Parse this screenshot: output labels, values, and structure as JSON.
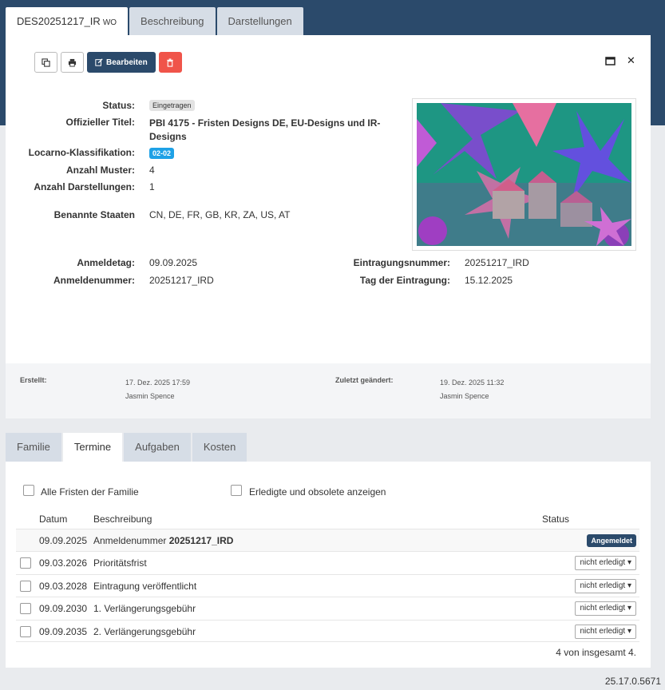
{
  "tabs": [
    {
      "label": "DES20251217_IR",
      "sub": "WO"
    },
    {
      "label": "Beschreibung"
    },
    {
      "label": "Darstellungen"
    }
  ],
  "toolbar": {
    "edit_label": "Bearbeiten"
  },
  "icons": {
    "copy": "copy-icon",
    "print": "print-icon",
    "edit": "edit-icon",
    "delete": "trash-icon",
    "maximize": "maximize-icon",
    "close": "close-icon"
  },
  "details": {
    "status_label": "Status:",
    "status_value": "Eingetragen",
    "title_label": "Offizieller Titel:",
    "title_line1": "PBI 4175 - Fristen Designs DE, EU-Designs und IR-",
    "title_line2": "Designs",
    "locarno_label": "Locarno-Klassifikation:",
    "locarno_value": "02-02",
    "muster_label": "Anzahl Muster:",
    "muster_value": "4",
    "darst_label": "Anzahl Darstellungen:",
    "darst_value": "1",
    "staaten_label": "Benannte Staaten",
    "staaten_value": "CN, DE, FR, GB, KR, ZA, US, AT",
    "anmeldetag_label": "Anmeldetag:",
    "anmeldetag_value": "09.09.2025",
    "anmeldenummer_label": "Anmeldenummer:",
    "anmeldenummer_value": "20251217_IRD",
    "eintragungsnummer_label": "Eintragungsnummer:",
    "eintragungsnummer_value": "20251217_IRD",
    "eintragungstag_label": "Tag der Eintragung:",
    "eintragungstag_value": "15.12.2025"
  },
  "meta": {
    "created_label": "Erstellt:",
    "created_date": "17. Dez. 2025 17:59",
    "created_by": "Jasmin Spence",
    "modified_label": "Zuletzt geändert:",
    "modified_date": "19. Dez. 2025 11:32",
    "modified_by": "Jasmin Spence"
  },
  "bottom_tabs": [
    "Familie",
    "Termine",
    "Aufgaben",
    "Kosten"
  ],
  "filters": {
    "family": "Alle Fristen der Familie",
    "completed": "Erledigte und obsolete anzeigen"
  },
  "table": {
    "headers": {
      "date": "Datum",
      "desc": "Beschreibung",
      "status": "Status"
    },
    "rows": [
      {
        "date": "09.09.2025",
        "desc": "Anmeldenummer ",
        "desc_bold": "20251217_IRD",
        "status": "Angemeldet"
      },
      {
        "date": "09.03.2026",
        "desc": "Prioritätsfrist",
        "status": "nicht erledigt"
      },
      {
        "date": "09.03.2028",
        "desc": "Eintragung veröffentlicht",
        "status": "nicht erledigt"
      },
      {
        "date": "09.09.2030",
        "desc": "1. Verlängerungsgebühr",
        "status": "nicht erledigt"
      },
      {
        "date": "09.09.2035",
        "desc": "2. Verlängerungsgebühr",
        "status": "nicht erledigt"
      }
    ],
    "count": "4 von insgesamt 4."
  },
  "version": "25.17.0.5671",
  "colors": {
    "header": "#2b4a6b",
    "danger": "#f0544a",
    "info": "#1ea1e6"
  }
}
